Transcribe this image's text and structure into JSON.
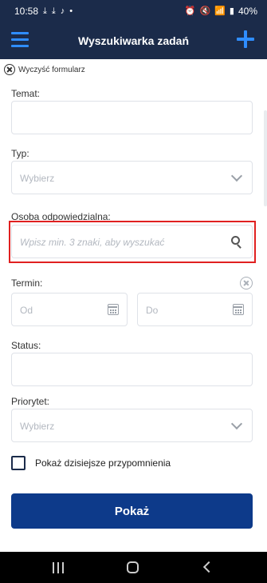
{
  "status_bar": {
    "time": "10:58",
    "battery": "40%",
    "left_icons": [
      "download-icon",
      "download-icon",
      "tiktok-icon",
      "dot-icon"
    ],
    "right_icons": [
      "alarm-icon",
      "mute-icon",
      "wifi-icon",
      "signal-icon"
    ]
  },
  "app_bar": {
    "title": "Wyszukiwarka zadań",
    "menu_icon": "hamburger-menu-icon",
    "add_icon": "plus-icon"
  },
  "clear_form": {
    "label": "Wyczyść formularz"
  },
  "form": {
    "temat": {
      "label": "Temat:",
      "value": ""
    },
    "typ": {
      "label": "Typ:",
      "placeholder": "Wybierz"
    },
    "osoba": {
      "label": "Osoba odpowiedzialna:",
      "placeholder": "Wpisz min. 3 znaki, aby wyszukać"
    },
    "termin": {
      "label": "Termin:",
      "from_placeholder": "Od",
      "to_placeholder": "Do"
    },
    "status": {
      "label": "Status:",
      "value": ""
    },
    "priorytet": {
      "label": "Priorytet:",
      "placeholder": "Wybierz"
    },
    "reminders": {
      "label": "Pokaż dzisiejsze przypomnienia",
      "checked": false
    }
  },
  "submit": {
    "label": "Pokaż"
  },
  "colors": {
    "app_bar": "#1b2b4a",
    "accent": "#2f8dff",
    "primary_button": "#0d3a8a",
    "highlight": "#e02020"
  }
}
